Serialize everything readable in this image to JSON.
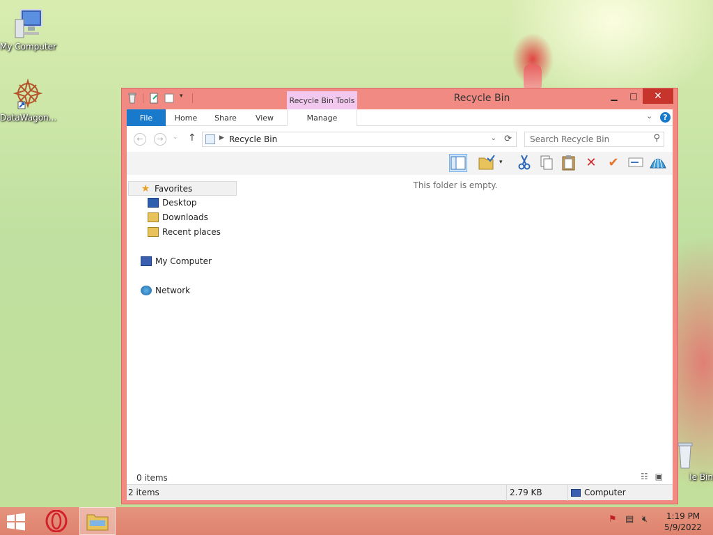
{
  "desktop": {
    "icons": [
      {
        "label": "My Computer",
        "icon": "computer-icon"
      },
      {
        "label": "DataWagon...",
        "icon": "datawagon-shortcut-icon"
      },
      {
        "label": "le Bin",
        "icon": "recycle-bin-icon"
      }
    ]
  },
  "window": {
    "title": "Recycle Bin",
    "context_tab": "Recycle Bin Tools",
    "buttons": {
      "minimize": "▁",
      "maximize": "□",
      "close": "✕"
    }
  },
  "ribbon": {
    "tabs": [
      "File",
      "Home",
      "Share",
      "View",
      "Manage"
    ],
    "help": "?"
  },
  "address": {
    "path": "Recycle Bin",
    "search_placeholder": "Search Recycle Bin"
  },
  "navpane": {
    "favorites": "Favorites",
    "desktop": "Desktop",
    "downloads": "Downloads",
    "recent": "Recent places",
    "computer": "My Computer",
    "network": "Network"
  },
  "content": {
    "empty": "This folder is empty.",
    "items_count": "0 items"
  },
  "statusbar": {
    "items": "2 items",
    "size": "2.79 KB",
    "location": "Computer"
  },
  "taskbar": {
    "time": "1:19 PM",
    "date": "5/9/2022"
  },
  "colors": {
    "accent": "#1979ca",
    "window_frame": "#f08a82",
    "close_button": "#c7342b",
    "context_tab": "#f2c8ee"
  }
}
